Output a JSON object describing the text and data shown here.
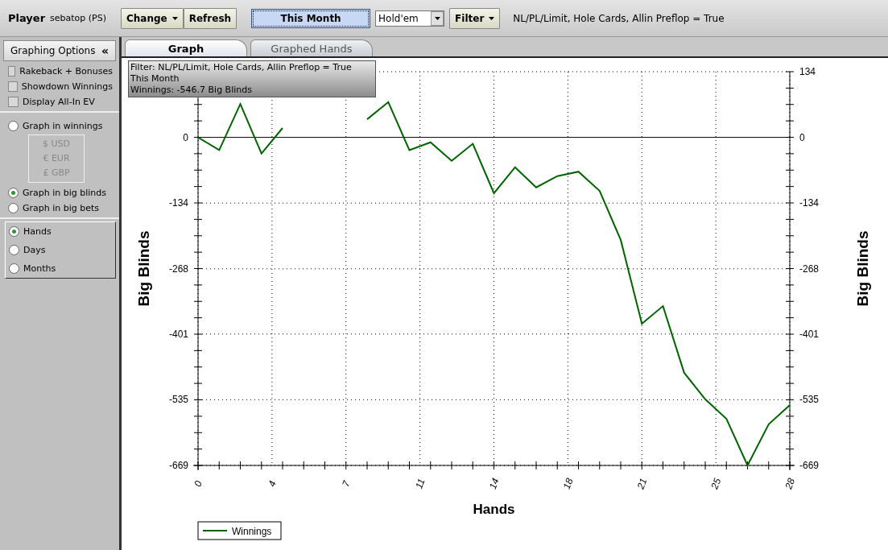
{
  "toolbar": {
    "player_label": "Player",
    "player_name": "sebatop (PS)",
    "buttons": [
      {
        "label": "Change",
        "kind": "dropdown"
      },
      {
        "label": "Refresh",
        "kind": "plain"
      }
    ],
    "period": {
      "label": "This Month",
      "selected": true
    },
    "game_select": {
      "value": "Hold'em"
    },
    "filter_button": {
      "label": "Filter"
    },
    "filter_text": "NL/PL/Limit, Hole Cards, Allin Preflop = True"
  },
  "sidebar": {
    "title": "Graphing Options",
    "collapse": "«",
    "checkboxes": [
      {
        "label": "Rakeback + Bonuses",
        "checked": false
      },
      {
        "label": "Showdown Winnings",
        "checked": false
      },
      {
        "label": "Display All-In EV",
        "checked": false
      }
    ],
    "units": [
      {
        "label": "Graph in winnings",
        "selected": false,
        "currencies": [
          {
            "label": "$ USD",
            "disabled": true
          },
          {
            "label": "€ EUR",
            "disabled": true
          },
          {
            "label": "£ GBP",
            "disabled": true
          }
        ]
      },
      {
        "label": "Graph in big blinds",
        "selected": true
      },
      {
        "label": "Graph in big bets",
        "selected": false
      }
    ],
    "x_axis": [
      {
        "label": "Hands",
        "selected": true
      },
      {
        "label": "Days",
        "selected": false
      },
      {
        "label": "Months",
        "selected": false
      }
    ]
  },
  "tabs": [
    {
      "label": "Graph",
      "selected": true
    },
    {
      "label": "Graphed Hands",
      "selected": false
    }
  ],
  "chart": {
    "tooltip": [
      "Filter: NL/PL/Limit, Hole Cards, Allin Preflop = True",
      "This Month",
      "Winnings: -546.7 Big Blinds"
    ],
    "right_axis": {
      "title": "Big Blinds",
      "tick_labels": [
        "134",
        "0",
        "-134",
        "-268",
        "-401",
        "-535",
        "-669"
      ]
    },
    "chart_data": {
      "type": "line",
      "xlabel": "Hands",
      "ylabel": "Big Blinds",
      "x": [
        0,
        1,
        2,
        3,
        4,
        5,
        6,
        7,
        8,
        9,
        10,
        11,
        12,
        13,
        14,
        15,
        16,
        17,
        18,
        19,
        20,
        21,
        22,
        23,
        24,
        25,
        26,
        27,
        28
      ],
      "series": [
        {
          "name": "Winnings",
          "color": "#006400",
          "values": [
            0,
            -26,
            68,
            -33,
            19,
            null,
            null,
            null,
            37,
            72,
            -26,
            -10,
            -48,
            -13,
            -114,
            -61,
            -102,
            -79,
            -70,
            -109,
            -209,
            -380,
            -344,
            -480,
            -534,
            -574,
            -669,
            -585,
            -546
          ]
        }
      ],
      "grid": true,
      "xlim": [
        0,
        28
      ],
      "ylim": [
        -669,
        134
      ],
      "xticks": [
        {
          "value": 0,
          "label": "0"
        },
        {
          "value": 3.5,
          "label": "4"
        },
        {
          "value": 7,
          "label": "7"
        },
        {
          "value": 10.5,
          "label": "11"
        },
        {
          "value": 14,
          "label": "14"
        },
        {
          "value": 17.5,
          "label": "18"
        },
        {
          "value": 21,
          "label": "21"
        },
        {
          "value": 24.5,
          "label": "25"
        },
        {
          "value": 28,
          "label": "28"
        }
      ],
      "yticks": [
        134,
        0,
        -134,
        -268,
        -401,
        -535,
        -669
      ]
    }
  }
}
